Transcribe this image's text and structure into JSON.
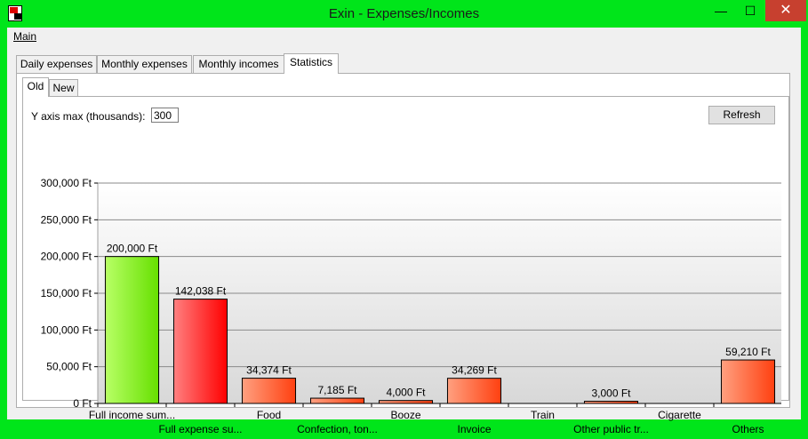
{
  "window": {
    "title": "Exin - Expenses/Incomes",
    "minimize_glyph": "—",
    "maximize_glyph": "☐",
    "close_glyph": "✕"
  },
  "menu": {
    "main": "Main"
  },
  "tabs": [
    {
      "label": "Daily expenses",
      "active": false
    },
    {
      "label": "Monthly expenses",
      "active": false
    },
    {
      "label": "Monthly incomes",
      "active": false
    },
    {
      "label": "Statistics",
      "active": true
    }
  ],
  "subtabs": [
    {
      "label": "Old",
      "active": true
    },
    {
      "label": "New",
      "active": false
    }
  ],
  "controls": {
    "y_axis_label": "Y axis max (thousands):",
    "y_axis_value": "300",
    "refresh_label": "Refresh"
  },
  "colors": {
    "income_top": "#b8ff66",
    "income_bottom": "#66e000",
    "expense_top": "#ff8080",
    "expense_bottom": "#ff0000",
    "category_top": "#ffa080",
    "category_bottom": "#ff4010"
  },
  "chart_data": {
    "type": "bar",
    "ylim": [
      0,
      300000
    ],
    "yticks": [
      {
        "value": 0,
        "label": "0 Ft"
      },
      {
        "value": 50000,
        "label": "50,000 Ft"
      },
      {
        "value": 100000,
        "label": "100,000 Ft"
      },
      {
        "value": 150000,
        "label": "150,000 Ft"
      },
      {
        "value": 200000,
        "label": "200,000 Ft"
      },
      {
        "value": 250000,
        "label": "250,000 Ft"
      },
      {
        "value": 300000,
        "label": "300,000 Ft"
      }
    ],
    "categories": [
      "Full income sum...",
      "Full expense su...",
      "Food",
      "Confection, ton...",
      "Booze",
      "Invoice",
      "Train",
      "Other public tr...",
      "Cigarette",
      "Others"
    ],
    "values": [
      200000,
      142038,
      34374,
      7185,
      4000,
      34269,
      0,
      3000,
      0,
      59210
    ],
    "value_labels": [
      "200,000 Ft",
      "142,038 Ft",
      "34,374 Ft",
      "7,185 Ft",
      "4,000 Ft",
      "34,269 Ft",
      "",
      "3,000 Ft",
      "",
      "59,210 Ft"
    ],
    "kinds": [
      "income",
      "expense",
      "category",
      "category",
      "category",
      "category",
      "category",
      "category",
      "category",
      "category"
    ],
    "grid": true
  }
}
